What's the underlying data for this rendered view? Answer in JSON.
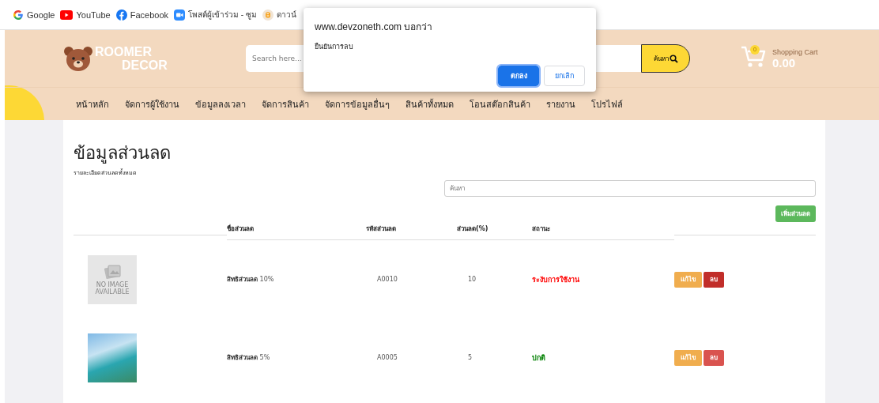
{
  "bookmarks": [
    {
      "kind": "google",
      "label": "Google"
    },
    {
      "kind": "youtube",
      "label": "YouTube"
    },
    {
      "kind": "facebook",
      "label": "Facebook"
    },
    {
      "kind": "zoom",
      "label": "โพสต์ผู้เข้าร่วม - ซูม"
    },
    {
      "kind": "blogger",
      "label": "ดาวน์"
    }
  ],
  "header": {
    "logo_top": "ROOMER",
    "logo_bottom": "DECOR",
    "search": {
      "placeholder": "Search here..."
    },
    "search_button": "ค้นหา",
    "cart": {
      "count": "0",
      "label": "Shopping Cart",
      "total": "0.00"
    }
  },
  "nav": [
    "หน้าหลัก",
    "จัดการผู้ใช้งาน",
    "ข้อมูลลงเวลา",
    "จัดการสินค้า",
    "จัดการข้อมูลอื่นๆ",
    "สินค้าทั้งหมด",
    "โอนสต๊อกสินค้า",
    "รายงาน",
    "โปรไฟล์"
  ],
  "dialog": {
    "title": "www.devzoneth.com บอกว่า",
    "message": "ยืนยันการลบ",
    "buttons": [
      {
        "label": "ตกลง",
        "kind": "primary"
      },
      {
        "label": "ยกเลิก",
        "kind": "secondary"
      }
    ]
  },
  "page": {
    "title": "ข้อมูลส่วนลด",
    "subtitle": "รายละเอียดส่วนลดทั้งหมด",
    "search": {
      "placeholder": "ค้นหา"
    },
    "add_button": "เพิ่มส่วนลด"
  },
  "table": {
    "columns": [
      "ชื่อส่วนลด",
      "รหัสส่วนลด",
      "ส่วนลด(%)",
      "สถานะ"
    ],
    "rows": [
      {
        "image": {
          "kind": "no-image",
          "text": "NO IMAGE AVAILABLE"
        },
        "name": "**สิทธิส่วนลด** 10%",
        "code": "A0010",
        "percent": "10",
        "status": {
          "label": "ระงับการใช้งาน",
          "color": "#ff0000"
        },
        "edit": "แก้ไข",
        "delete": "ลบ",
        "delete_focused": true
      },
      {
        "image": {
          "kind": "photo"
        },
        "name": "**สิทธิส่วนลด** 5%",
        "code": "A0005",
        "percent": "5",
        "status": {
          "label": "ปกติ",
          "color": "#008000"
        },
        "edit": "แก้ไข",
        "delete": "ลบ",
        "delete_focused": false
      }
    ]
  }
}
